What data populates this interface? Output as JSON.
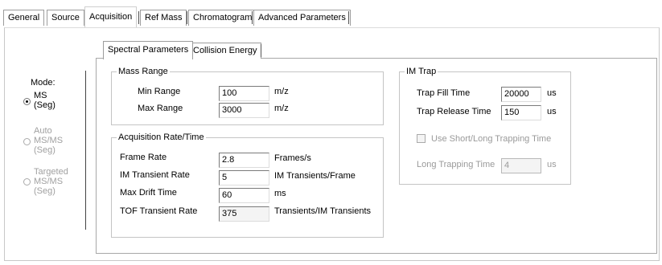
{
  "top_tabs": [
    "General",
    "Source",
    "Acquisition",
    "Ref Mass",
    "Chromatogram",
    "Advanced Parameters"
  ],
  "mode": {
    "label": "Mode:",
    "options": [
      {
        "line1": "MS",
        "line2": "(Seg)",
        "line3": "",
        "checked": true,
        "enabled": true
      },
      {
        "line1": "Auto",
        "line2": "MS/MS",
        "line3": "(Seg)",
        "checked": false,
        "enabled": false
      },
      {
        "line1": "Targeted",
        "line2": "MS/MS",
        "line3": "(Seg)",
        "checked": false,
        "enabled": false
      }
    ]
  },
  "sub_tabs": [
    "Spectral Parameters",
    "Collision Energy"
  ],
  "mass_range": {
    "title": "Mass Range",
    "min_label": "Min Range",
    "min_value": "100",
    "min_unit": "m/z",
    "max_label": "Max Range",
    "max_value": "3000",
    "max_unit": "m/z"
  },
  "acq_rate": {
    "title": "Acquisition Rate/Time",
    "frame_rate_label": "Frame Rate",
    "frame_rate_value": "2.8",
    "frame_rate_unit": "Frames/s",
    "im_transient_label": "IM Transient Rate",
    "im_transient_value": "5",
    "im_transient_unit": "IM Transients/Frame",
    "max_drift_label": "Max Drift Time",
    "max_drift_value": "60",
    "max_drift_unit": "ms",
    "tof_transient_label": "TOF Transient Rate",
    "tof_transient_value": "375",
    "tof_transient_unit": "Transients/IM Transients"
  },
  "im_trap": {
    "title": "IM Trap",
    "fill_label": "Trap Fill Time",
    "fill_value": "20000",
    "fill_unit": "us",
    "release_label": "Trap Release Time",
    "release_value": "150",
    "release_unit": "us",
    "short_long_label": "Use Short/Long Trapping Time",
    "short_long_checked": false,
    "long_label": "Long Trapping Time",
    "long_value": "4",
    "long_unit": "us"
  }
}
